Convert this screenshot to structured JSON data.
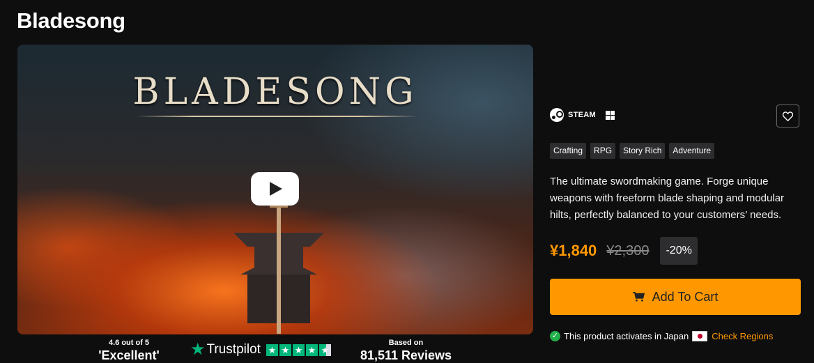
{
  "title": "Bladesong",
  "media": {
    "logo_text": "BLADESONG"
  },
  "trustpilot": {
    "score_line": "4.6 out of 5",
    "rating_word": "'Excellent'",
    "brand": "Trustpilot",
    "based_on": "Based on",
    "reviews": "81,511 Reviews",
    "stars": 4.6
  },
  "platform": {
    "store": "STEAM",
    "os_icon": "windows-icon"
  },
  "tags": [
    "Crafting",
    "RPG",
    "Story Rich",
    "Adventure"
  ],
  "description": "The ultimate swordmaking game. Forge unique weapons with freeform blade shaping and modular hilts, perfectly balanced to your customers’ needs.",
  "pricing": {
    "price": "¥1,840",
    "original_price": "¥2,300",
    "discount": "-20%"
  },
  "cart": {
    "label": "Add To Cart"
  },
  "activation": {
    "text": "This product activates in Japan",
    "link": "Check Regions"
  },
  "colors": {
    "accent": "#ff9800",
    "background": "#0e0e0f",
    "tag_bg": "#2d2d2f",
    "trustpilot_green": "#00b67a"
  }
}
